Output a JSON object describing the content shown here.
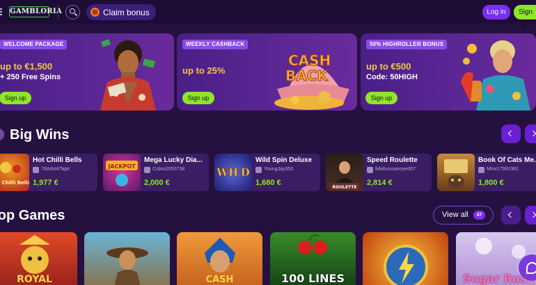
{
  "header": {
    "logo": "GAMBLORIA",
    "claim_bonus": "Claim bonus",
    "login": "Log in",
    "signup": "Sign up"
  },
  "promos": [
    {
      "tag": "WELCOME PACKAGE",
      "line1": "up to €1,500",
      "line2": "+ 250 Free Spins",
      "button": "Sign up"
    },
    {
      "tag": "WEEKLY CASHBACK",
      "line1": "up to 25%",
      "line2": "",
      "button": "Sign up",
      "art_text_1": "CASH",
      "art_text_2": "BACK"
    },
    {
      "tag": "50% HIGHROLLER BONUS",
      "line1": "up to €500",
      "line2": "Code: 50HIGH",
      "button": "Sign up"
    }
  ],
  "big_wins": {
    "title": "Big Wins",
    "items": [
      {
        "game": "Hot Chilli Bells",
        "user": "78AdroitTapir",
        "amount": "1,977 €",
        "thumb_text": "Hot Chilli Bells"
      },
      {
        "game": "Mega Lucky Dia...",
        "user": "Cobra2050738",
        "amount": "2,000 €",
        "thumb_text": "JACKPOT"
      },
      {
        "game": "Wild Spin Deluxe",
        "user": "YoungJay350",
        "amount": "1,680 €",
        "thumb_text": "WILD"
      },
      {
        "game": "Speed Roulette",
        "user": "fidahussainsyed07",
        "amount": "2,814 €",
        "thumb_text": "ROULETTE"
      },
      {
        "game": "Book Of Cats Me...",
        "user": "Minx17992381",
        "amount": "1,800 €",
        "thumb_text": ""
      }
    ]
  },
  "top_games": {
    "title": "Top Games",
    "view_all": "View all",
    "count": "47",
    "tiles": [
      {
        "label": "ROYAL",
        "color": "#c2361e"
      },
      {
        "label": "",
        "color": "#2c5a7a"
      },
      {
        "label": "CASH",
        "color": "#d08a2a"
      },
      {
        "label": "100 LINES",
        "color": "#1a4f1e"
      },
      {
        "label": "",
        "color": "#e4731c"
      },
      {
        "label": "Sugar Rush",
        "color": "#c9b8e6"
      }
    ]
  }
}
